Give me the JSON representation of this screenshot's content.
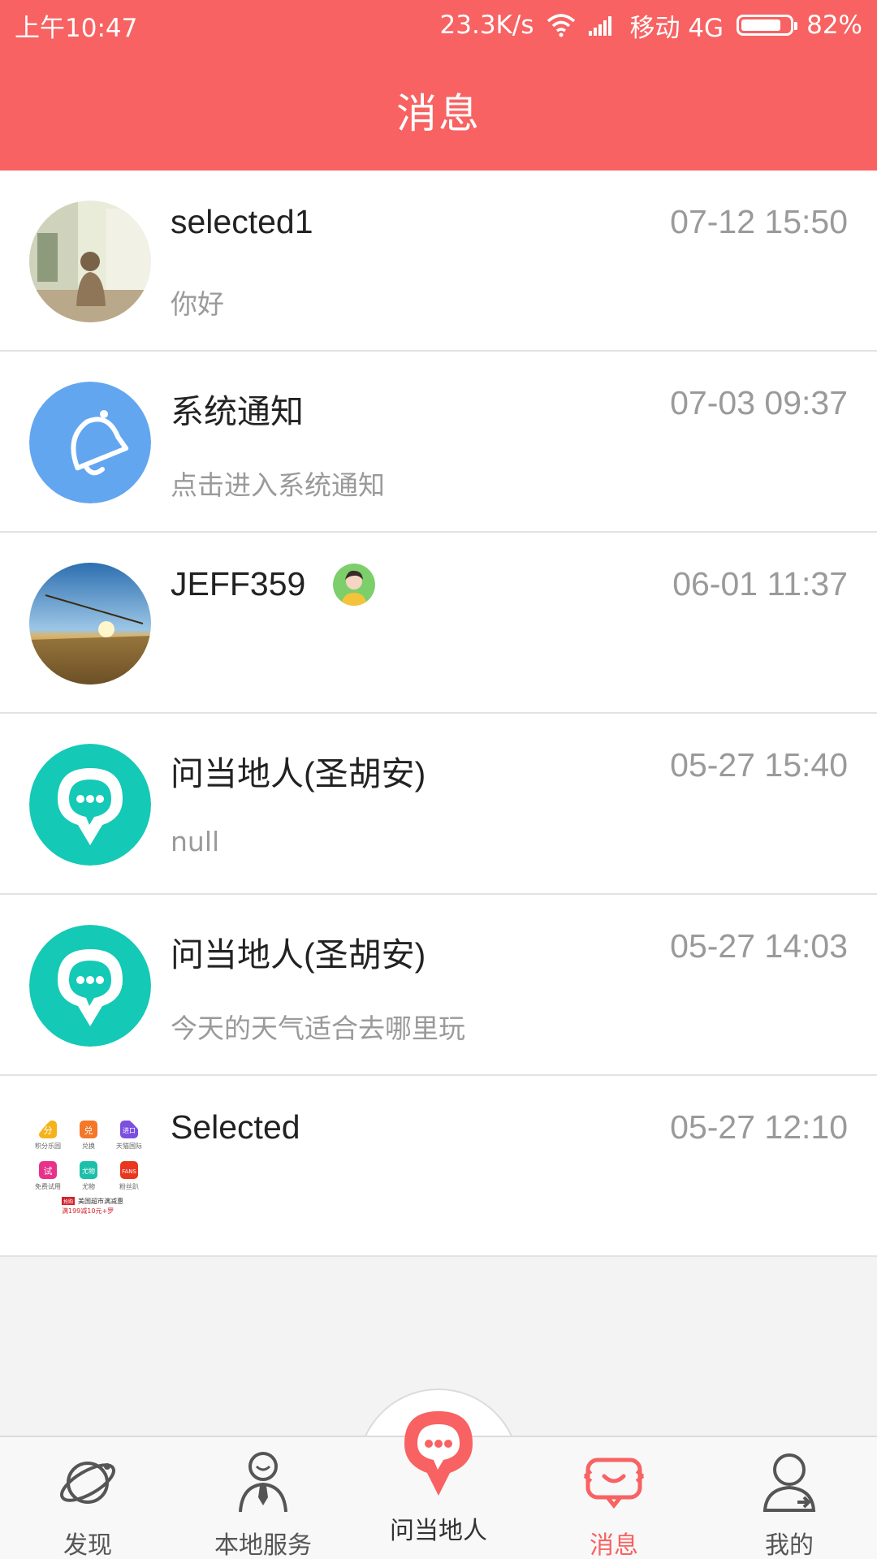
{
  "status_bar": {
    "time": "上午10:47",
    "net_speed": "23.3K/s",
    "carrier": "移动 4G",
    "battery": "82%",
    "battery_level": 0.82
  },
  "header": {
    "title": "消息"
  },
  "conversations": [
    {
      "name": "selected1",
      "time": "07-12 15:50",
      "preview": "你好",
      "avatar": "photo-avatar"
    },
    {
      "name": "系统通知",
      "time": "07-03 09:37",
      "preview": "点击进入系统通知",
      "avatar": "bell-icon"
    },
    {
      "name": "JEFF359",
      "time": "06-01 11:37",
      "preview": "",
      "avatar": "photo-avatar"
    },
    {
      "name": "问当地人(圣胡安)",
      "time": "05-27 15:40",
      "preview": "null",
      "avatar": "chat-pin-icon"
    },
    {
      "name": "问当地人(圣胡安)",
      "time": "05-27 14:03",
      "preview": "今天的天气适合去哪里玩",
      "avatar": "chat-pin-icon"
    },
    {
      "name": "Selected",
      "time": "05-27 12:10",
      "preview": "",
      "avatar": "app-grid-avatar"
    }
  ],
  "tabbar": {
    "tabs": [
      {
        "label": "发现",
        "icon": "orbit-icon"
      },
      {
        "label": "本地服务",
        "icon": "person-tie-icon"
      },
      {
        "label": "问当地人",
        "icon": "chat-pin-icon"
      },
      {
        "label": "消息",
        "icon": "message-icon",
        "active": true
      },
      {
        "label": "我的",
        "icon": "profile-icon"
      }
    ]
  },
  "colors": {
    "accent": "#f86262",
    "teal": "#14c9b6",
    "bell_bg": "#62a6f0"
  },
  "avatar_grid": {
    "items": [
      "分",
      "兑",
      "进口",
      "试",
      "尤物",
      "FANS"
    ],
    "captions": [
      "积分乐园",
      "兑换",
      "天猫国际",
      "免费试用",
      "尤物",
      "粉丝趴"
    ],
    "promo_tag": "抢购",
    "promo_text": "美国超市满减惠",
    "promo_sub": "满199减10元+罗"
  }
}
